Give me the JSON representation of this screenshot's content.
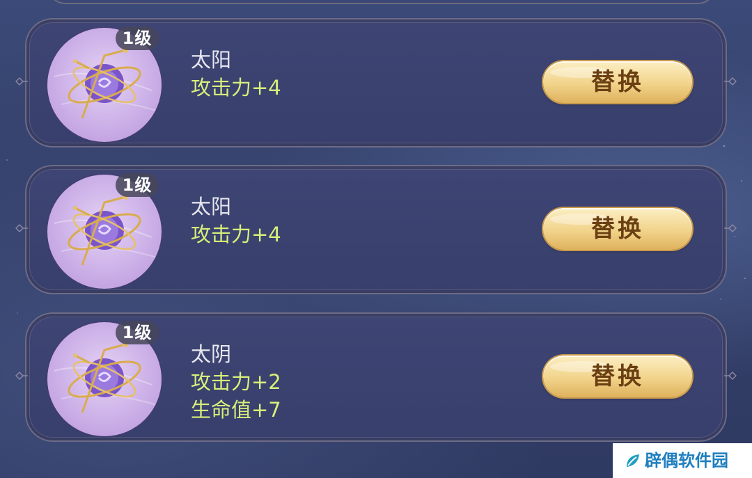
{
  "cards": [
    {
      "level": "1级",
      "star_name": "太阳",
      "stats": [
        "攻击力+4"
      ],
      "button_label": "替换"
    },
    {
      "level": "1级",
      "star_name": "太阳",
      "stats": [
        "攻击力+4"
      ],
      "button_label": "替换"
    },
    {
      "level": "1级",
      "star_name": "太阴",
      "stats": [
        "攻击力+2",
        "生命值+7"
      ],
      "button_label": "替换"
    }
  ],
  "watermark": {
    "text": "辟偶软件园",
    "icon": "leaf-logo-icon"
  },
  "colors": {
    "stat_text": "#d8f07a",
    "name_text": "#e8e8f0",
    "button_gold": "#f1d38a",
    "panel": "#3e4574",
    "emblem": "#d0b6ea",
    "watermark_text": "#1f7fbf"
  }
}
